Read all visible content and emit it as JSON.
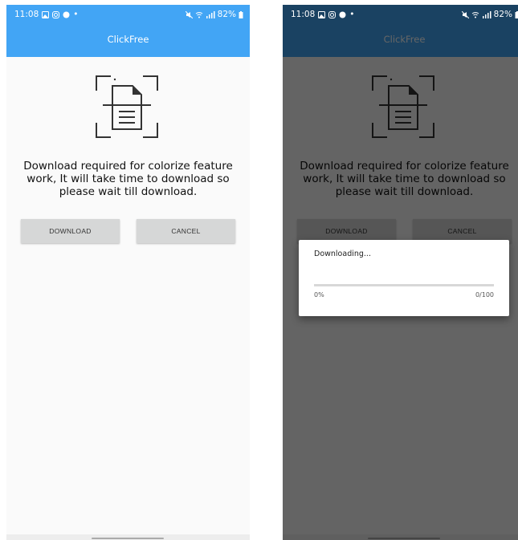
{
  "status_bar": {
    "time": "11:08",
    "battery": "82%"
  },
  "app": {
    "title": "ClickFree"
  },
  "colors": {
    "accent": "#42a5f5",
    "button_bg": "#d6d7d7"
  },
  "main": {
    "icon": "document-scan-icon",
    "message": "Download required for colorize feature work, It will take time to download so please wait till download.",
    "download_label": "DOWNLOAD",
    "cancel_label": "CANCEL"
  },
  "dialog": {
    "title": "Downloading...",
    "progress_fraction": 0,
    "percent_text": "0%",
    "count_text": "0/100"
  }
}
